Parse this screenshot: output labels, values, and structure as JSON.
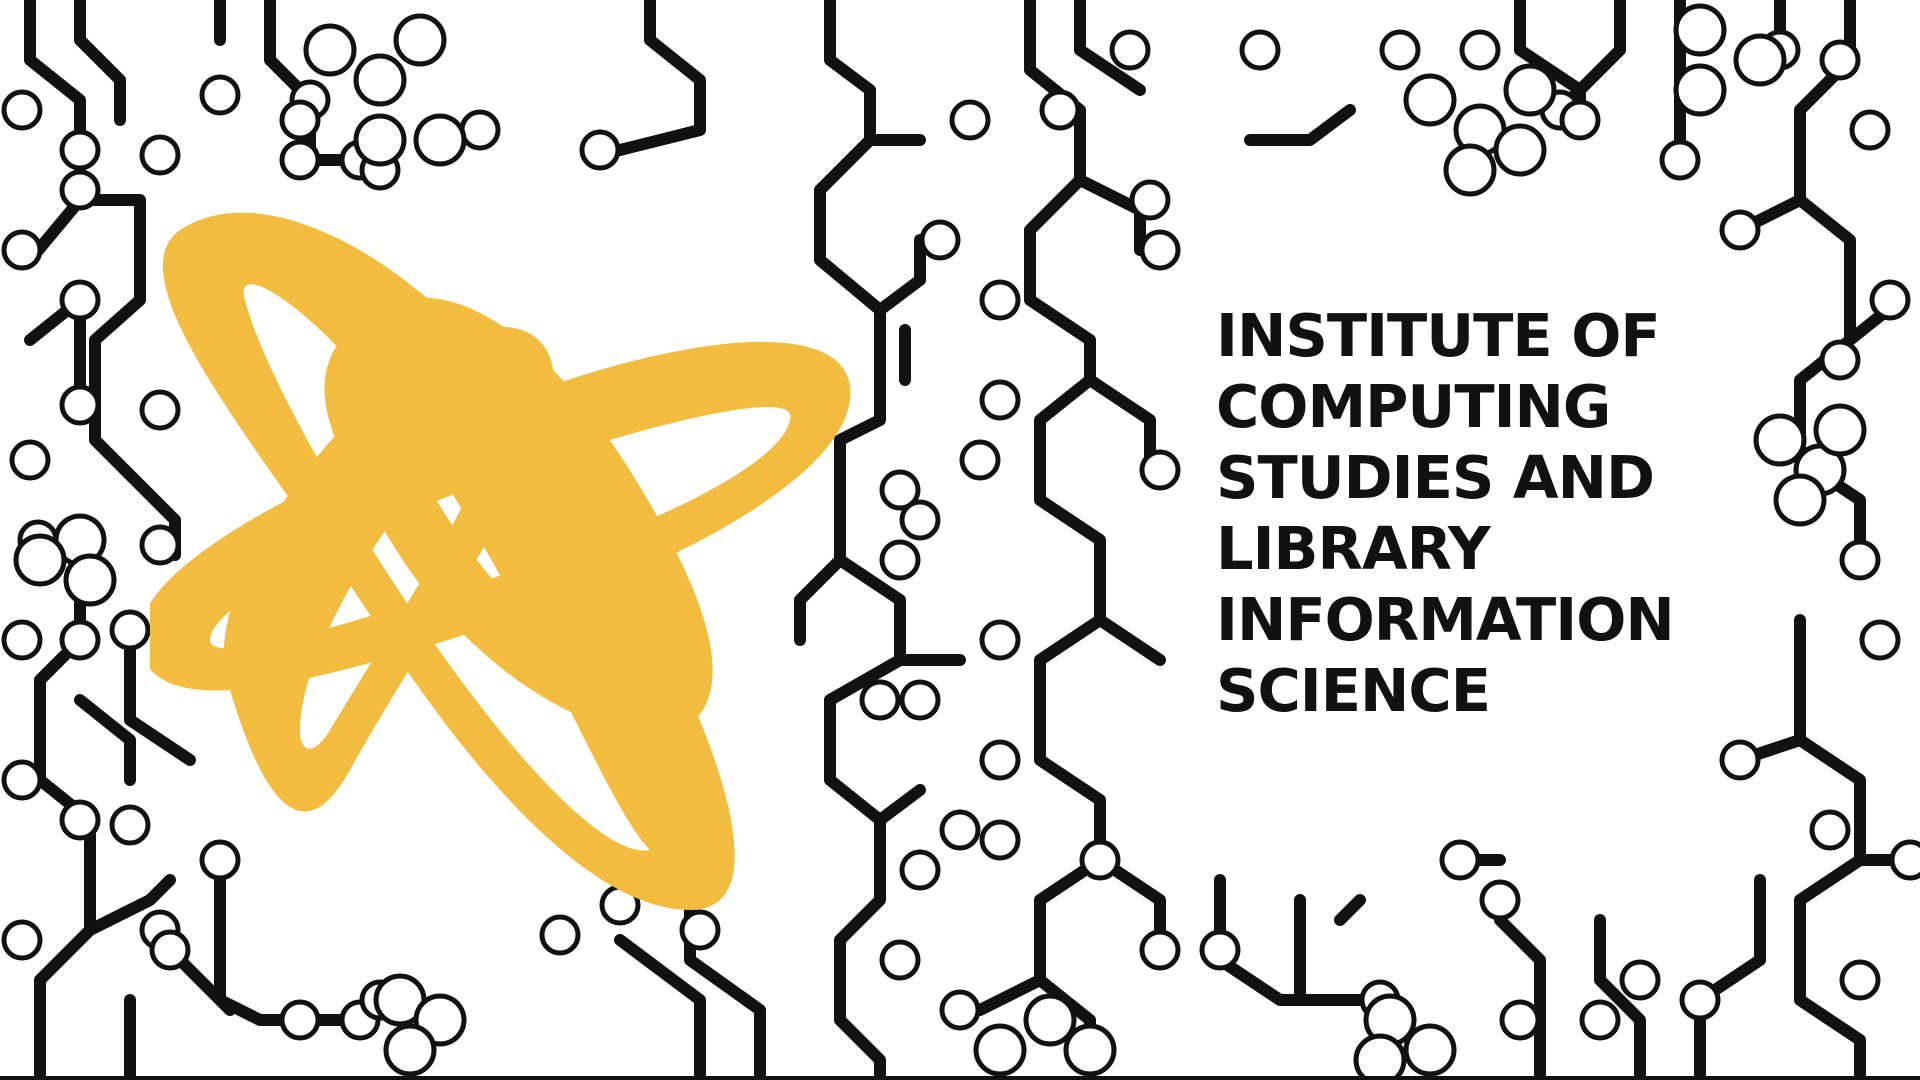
{
  "colors": {
    "background": "#ffffff",
    "trace": "#111111",
    "logo": "#F2BD3F"
  },
  "logo": {
    "icon": "atom-knot-icon"
  },
  "institute": {
    "lines": [
      "INSTITUTE OF",
      "COMPUTING",
      "STUDIES AND",
      "LIBRARY",
      "INFORMATION",
      "SCIENCE"
    ]
  }
}
